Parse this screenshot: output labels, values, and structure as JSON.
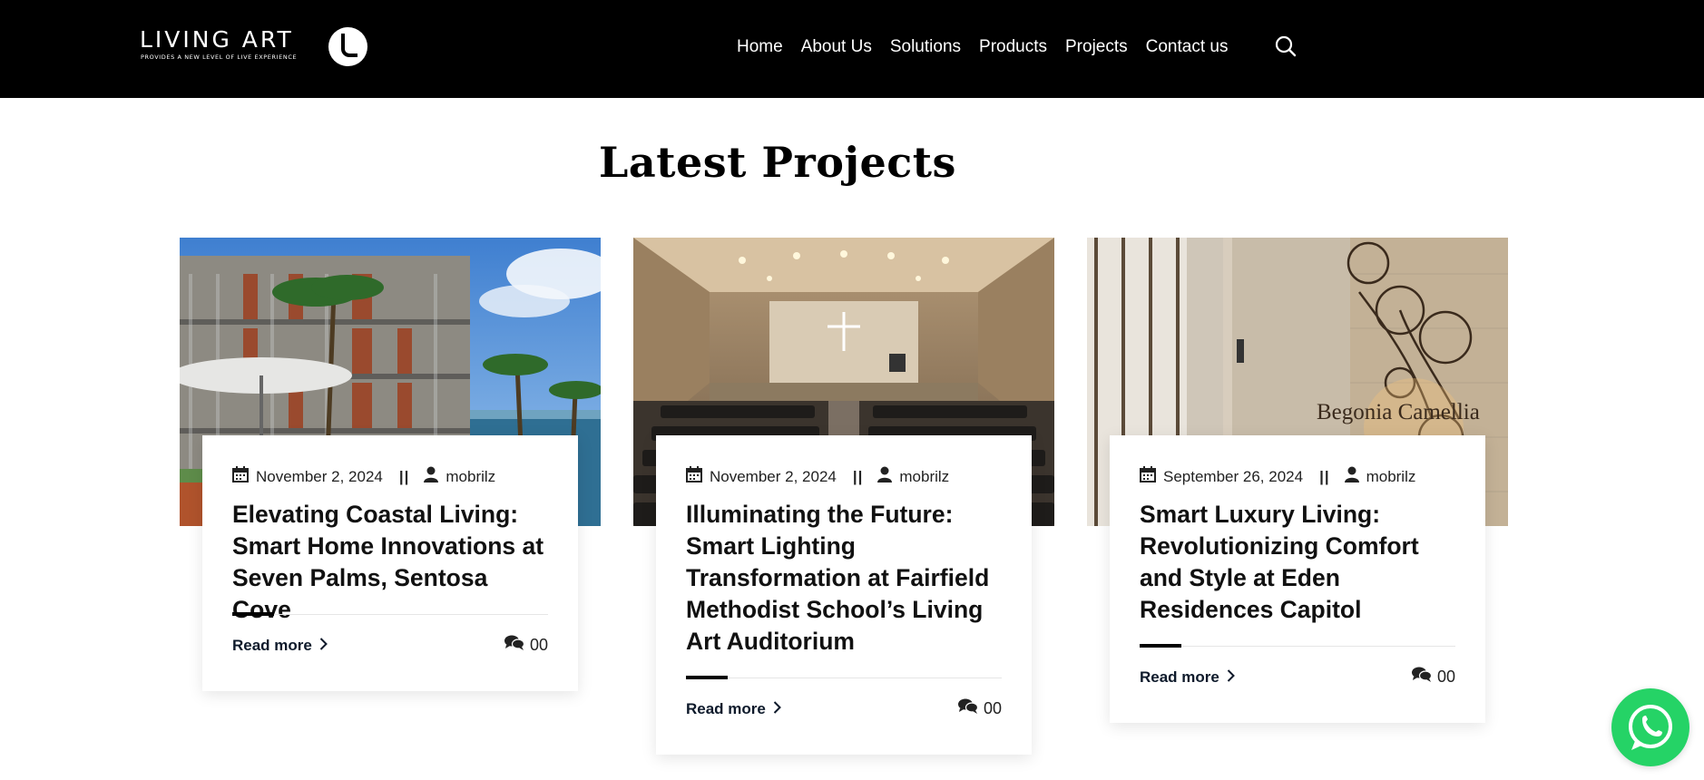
{
  "brand": {
    "name": "LIVING ART",
    "tagline": "PROVIDES A NEW LEVEL OF LIVE EXPERIENCE",
    "badge_letter": "L"
  },
  "nav": {
    "items": [
      {
        "label": "Home"
      },
      {
        "label": "About Us"
      },
      {
        "label": "Solutions"
      },
      {
        "label": "Products"
      },
      {
        "label": "Projects"
      },
      {
        "label": "Contact us"
      }
    ],
    "search_icon": "search-icon"
  },
  "section": {
    "title": "Latest Projects"
  },
  "cards": [
    {
      "date": "November 2, 2024",
      "separator": "||",
      "author": "mobrilz",
      "title": "Elevating Coastal Living: Smart Home Innovations at Seven Palms, Sentosa Cove",
      "read_more": "Read more",
      "comments": "00"
    },
    {
      "date": "November 2, 2024",
      "separator": "||",
      "author": "mobrilz",
      "title": "Illuminating the Future: Smart Lighting Transformation at Fairfield Methodist School’s Living Art Auditorium",
      "read_more": "Read more",
      "comments": "00"
    },
    {
      "date": "September 26, 2024",
      "separator": "||",
      "author": "mobrilz",
      "title": "Smart Luxury Living: Revolutionizing Comfort and Style at Eden Residences Capitol",
      "read_more": "Read more",
      "comments": "00",
      "image_text": "Begonia Camellia"
    }
  ],
  "colors": {
    "header_bg": "#000000",
    "whatsapp": "#25d366",
    "read_more": "#0e1a2b"
  }
}
